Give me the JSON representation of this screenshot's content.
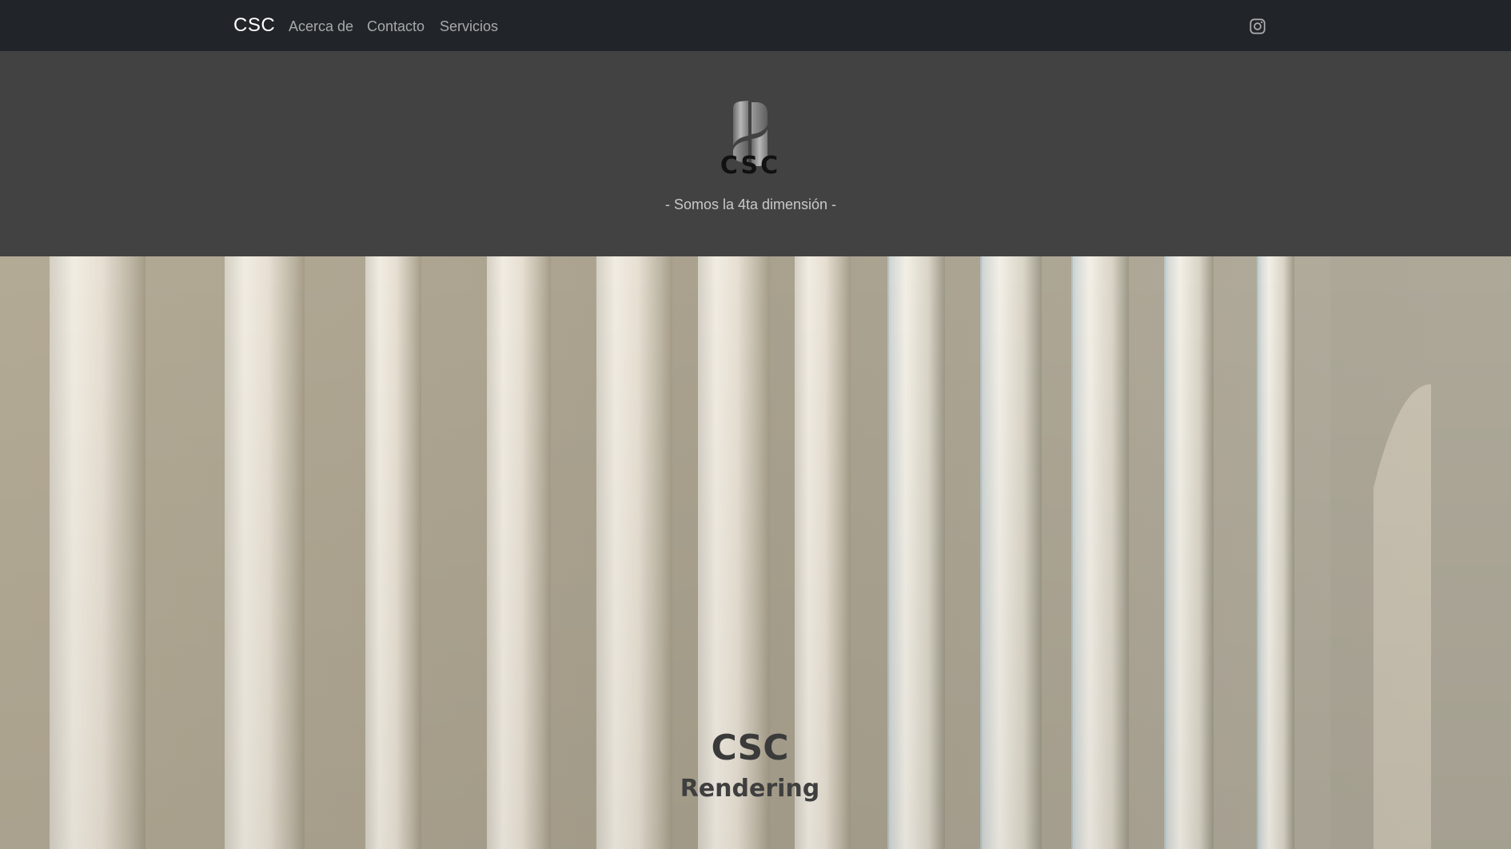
{
  "navbar": {
    "brand": "CSC",
    "links": [
      {
        "label": "Acerca de"
      },
      {
        "label": "Contacto"
      },
      {
        "label": "Servicios"
      }
    ],
    "social_icon": "instagram-icon",
    "background": "#212529"
  },
  "header": {
    "logo_text": "CSC",
    "tagline": "- Somos la 4ta dimensión -",
    "background": "#424242"
  },
  "hero": {
    "title": "CSC",
    "subtitle": "Rendering",
    "background_image": "vertical white columns with shadows on beige wall"
  }
}
